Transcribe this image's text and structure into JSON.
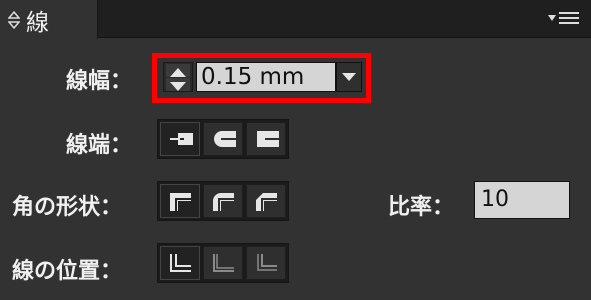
{
  "panel": {
    "tab_title": "線",
    "menu_icon": "panel-menu-icon"
  },
  "stroke": {
    "weight_label": "線幅：",
    "weight_value": "0.15 mm",
    "cap_label": "線端：",
    "corner_label": "角の形状：",
    "ratio_label": "比率：",
    "ratio_value": "10",
    "align_label": "線の位置："
  },
  "colors": {
    "highlight": "#ff0000",
    "panel_bg": "#323232",
    "field_bg": "#d5d5d5"
  }
}
